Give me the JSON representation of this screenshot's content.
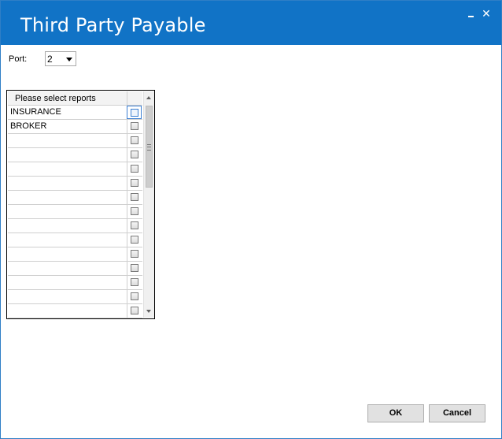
{
  "window": {
    "title": "Third Party Payable",
    "minimize_icon": "minimize-icon",
    "close_icon": "close-icon",
    "close_glyph": "✕"
  },
  "port": {
    "label": "Port:",
    "value": "2"
  },
  "reports": {
    "header": "Please select reports",
    "rows": [
      {
        "name": "INSURANCE",
        "checked": false,
        "selected": true
      },
      {
        "name": "BROKER",
        "checked": false
      },
      {
        "name": "",
        "checked": false
      },
      {
        "name": "",
        "checked": false
      },
      {
        "name": "",
        "checked": false
      },
      {
        "name": "",
        "checked": false
      },
      {
        "name": "",
        "checked": false
      },
      {
        "name": "",
        "checked": false
      },
      {
        "name": "",
        "checked": false
      },
      {
        "name": "",
        "checked": false
      },
      {
        "name": "",
        "checked": false
      },
      {
        "name": "",
        "checked": false
      },
      {
        "name": "",
        "checked": false
      },
      {
        "name": "",
        "checked": false
      },
      {
        "name": "",
        "checked": false
      }
    ]
  },
  "buttons": {
    "ok": "OK",
    "cancel": "Cancel"
  },
  "colors": {
    "titlebar": "#1173c6",
    "selection": "#3c7fd2"
  }
}
